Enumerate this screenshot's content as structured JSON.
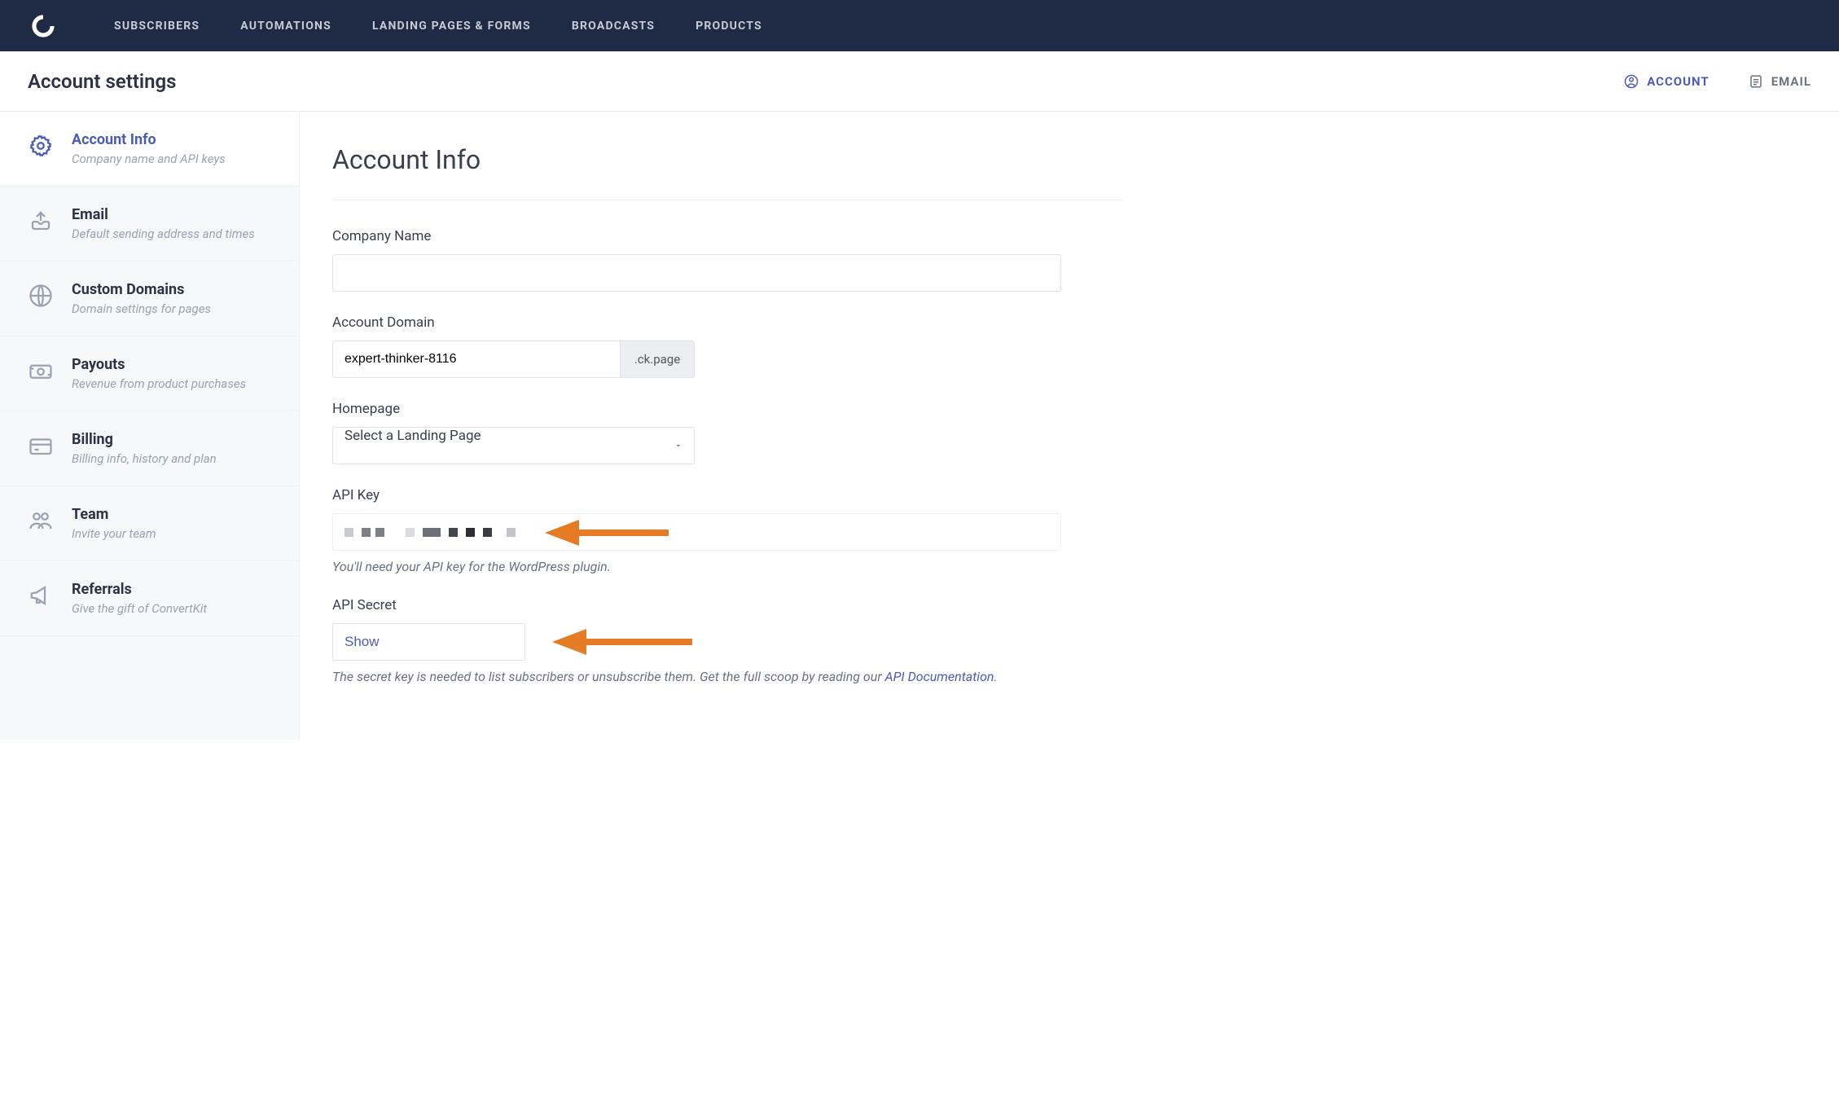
{
  "topnav": {
    "items": [
      "SUBSCRIBERS",
      "AUTOMATIONS",
      "LANDING PAGES & FORMS",
      "BROADCASTS",
      "PRODUCTS"
    ]
  },
  "subheader": {
    "title": "Account settings",
    "tabs": [
      {
        "label": "ACCOUNT",
        "active": true
      },
      {
        "label": "EMAIL",
        "active": false
      }
    ]
  },
  "sidebar": {
    "items": [
      {
        "title": "Account Info",
        "desc": "Company name and API keys",
        "icon": "gear",
        "active": true
      },
      {
        "title": "Email",
        "desc": "Default sending address and times",
        "icon": "outbox",
        "active": false
      },
      {
        "title": "Custom Domains",
        "desc": "Domain settings for pages",
        "icon": "globe",
        "active": false
      },
      {
        "title": "Payouts",
        "desc": "Revenue from product purchases",
        "icon": "cash",
        "active": false
      },
      {
        "title": "Billing",
        "desc": "Billing info, history and plan",
        "icon": "card",
        "active": false
      },
      {
        "title": "Team",
        "desc": "Invite your team",
        "icon": "team",
        "active": false
      },
      {
        "title": "Referrals",
        "desc": "Give the gift of ConvertKit",
        "icon": "megaphone",
        "active": false
      }
    ]
  },
  "content": {
    "heading": "Account Info",
    "company_name": {
      "label": "Company Name",
      "value": ""
    },
    "account_domain": {
      "label": "Account Domain",
      "value": "expert-thinker-8116",
      "suffix": ".ck.page"
    },
    "homepage": {
      "label": "Homepage",
      "selected": "Select a Landing Page"
    },
    "api_key": {
      "label": "API Key",
      "help": "You'll need your API key for the WordPress plugin."
    },
    "api_secret": {
      "label": "API Secret",
      "show_label": "Show",
      "help_prefix": "The secret key is needed to list subscribers or unsubscribe them. Get the full scoop by reading our ",
      "help_link": "API Documentation",
      "help_suffix": "."
    }
  }
}
